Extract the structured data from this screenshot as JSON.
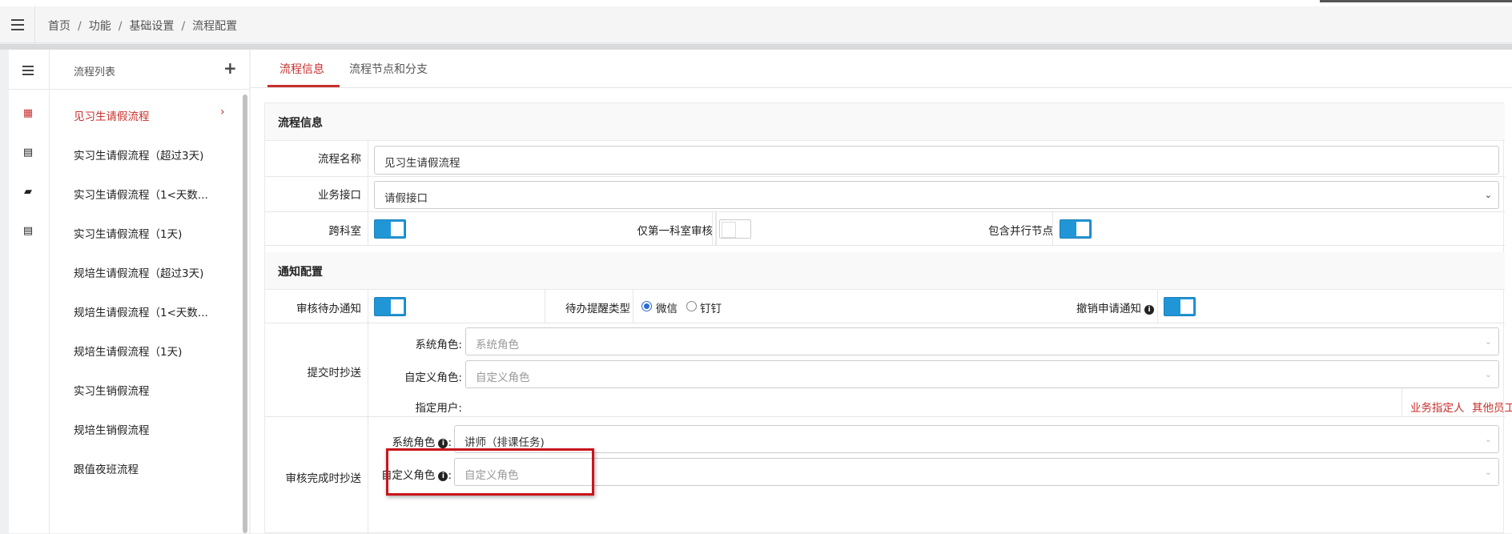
{
  "breadcrumb": {
    "items": [
      "首页",
      "功能",
      "基础设置",
      "流程配置"
    ],
    "separator": "/"
  },
  "sidebar": {
    "title": "流程列表",
    "add_label": "+",
    "items": [
      {
        "label": "见习生请假流程",
        "icon": "calendar-icon",
        "active": true
      },
      {
        "label": "实习生请假流程（超过3天)",
        "icon": "file-icon"
      },
      {
        "label": "实习生请假流程（1<天数...",
        "icon": "book-icon"
      },
      {
        "label": "实习生请假流程（1天)",
        "icon": "file-icon"
      },
      {
        "label": "规培生请假流程（超过3天)"
      },
      {
        "label": "规培生请假流程（1<天数..."
      },
      {
        "label": "规培生请假流程（1天)"
      },
      {
        "label": "实习生销假流程"
      },
      {
        "label": "规培生销假流程"
      },
      {
        "label": "跟值夜班流程"
      }
    ]
  },
  "tabs": [
    {
      "label": "流程信息",
      "active": true
    },
    {
      "label": "流程节点和分支",
      "active": false
    }
  ],
  "flow_info": {
    "section_title": "流程信息",
    "name_label": "流程名称",
    "name_value": "见习生请假流程",
    "interface_label": "业务接口",
    "interface_value": "请假接口",
    "cross_dept_label": "跨科室",
    "cross_dept_on": true,
    "first_dept_label": "仅第一科室审核",
    "first_dept_on": false,
    "parallel_label": "包含并行节点",
    "parallel_on": true
  },
  "notify": {
    "section_title": "通知配置",
    "pending_label": "审核待办通知",
    "pending_on": true,
    "remind_type_label": "待办提醒类型",
    "remind_options": [
      "微信",
      "钉钉"
    ],
    "remind_selected": "微信",
    "revoke_label": "撤销申请通知",
    "revoke_on": true,
    "submit_cc_label": "提交时抄送",
    "submit": {
      "sys_role_label": "系统角色:",
      "sys_role_placeholder": "系统角色",
      "custom_role_label": "自定义角色:",
      "custom_role_placeholder": "自定义角色",
      "user_label": "指定用户:",
      "link_business": "业务指定人",
      "link_other": "其他员工"
    },
    "complete_cc_label": "审核完成时抄送",
    "complete": {
      "sys_role_label": "系统角色",
      "sys_role_value": "讲师（排课任务)",
      "custom_role_label": "自定义角色",
      "custom_role_placeholder": "自定义角色",
      "colon": ":"
    }
  },
  "colors": {
    "accent_red": "#c9302c",
    "switch_blue": "#2196d6",
    "highlight_red": "#c9151b"
  }
}
